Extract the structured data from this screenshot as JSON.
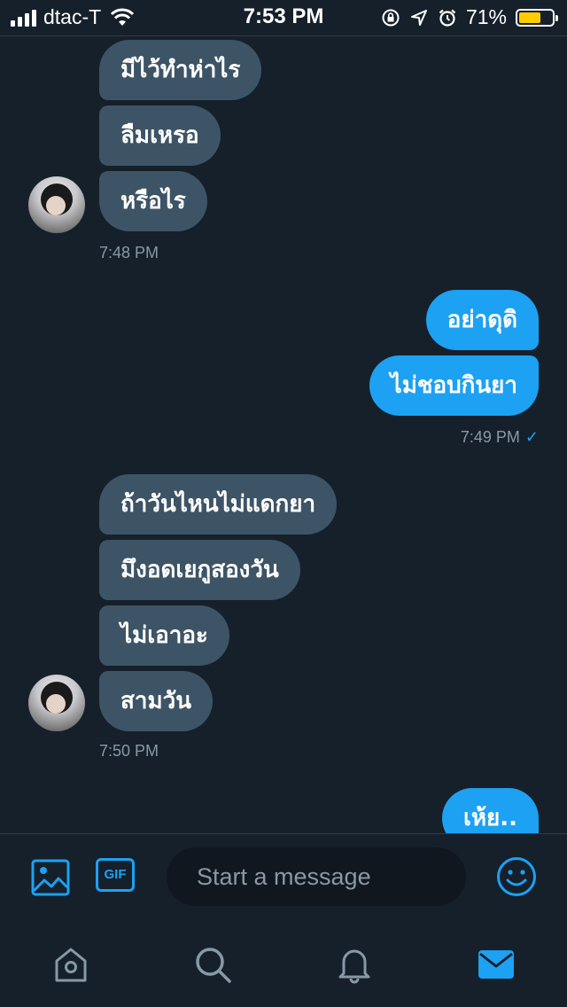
{
  "status_bar": {
    "carrier": "dtac-T",
    "time": "7:53 PM",
    "battery_percent": "71%",
    "battery_level": 0.71,
    "battery_color": "#ffcc00"
  },
  "messages": {
    "group1": [
      "มีไว้ทำห่าไร",
      "ลืมเหรอ",
      "หรือไร"
    ],
    "time1": "7:48 PM",
    "group2": [
      "อย่าดุดิ",
      "ไม่ชอบกินยา"
    ],
    "time2": "7:49 PM",
    "group3": [
      "ถ้าวันไหนไม่แดกยา",
      "มึงอดเยกูสองวัน",
      "ไม่เอาอะ",
      "สามวัน"
    ],
    "time3": "7:50 PM",
    "group4": [
      "เห้ย.."
    ]
  },
  "composer": {
    "gif_label": "GIF",
    "placeholder": "Start a message"
  },
  "icons": {
    "photo": "image-icon",
    "gif": "gif-icon",
    "emoji": "emoji-icon",
    "home": "home-icon",
    "search": "search-icon",
    "notifications": "bell-icon",
    "messages": "mail-icon"
  },
  "colors": {
    "background": "#15202b",
    "incoming_bubble": "#3d5466",
    "outgoing_bubble": "#1da1f2",
    "accent": "#1da1f2",
    "secondary_text": "#8899a6"
  }
}
